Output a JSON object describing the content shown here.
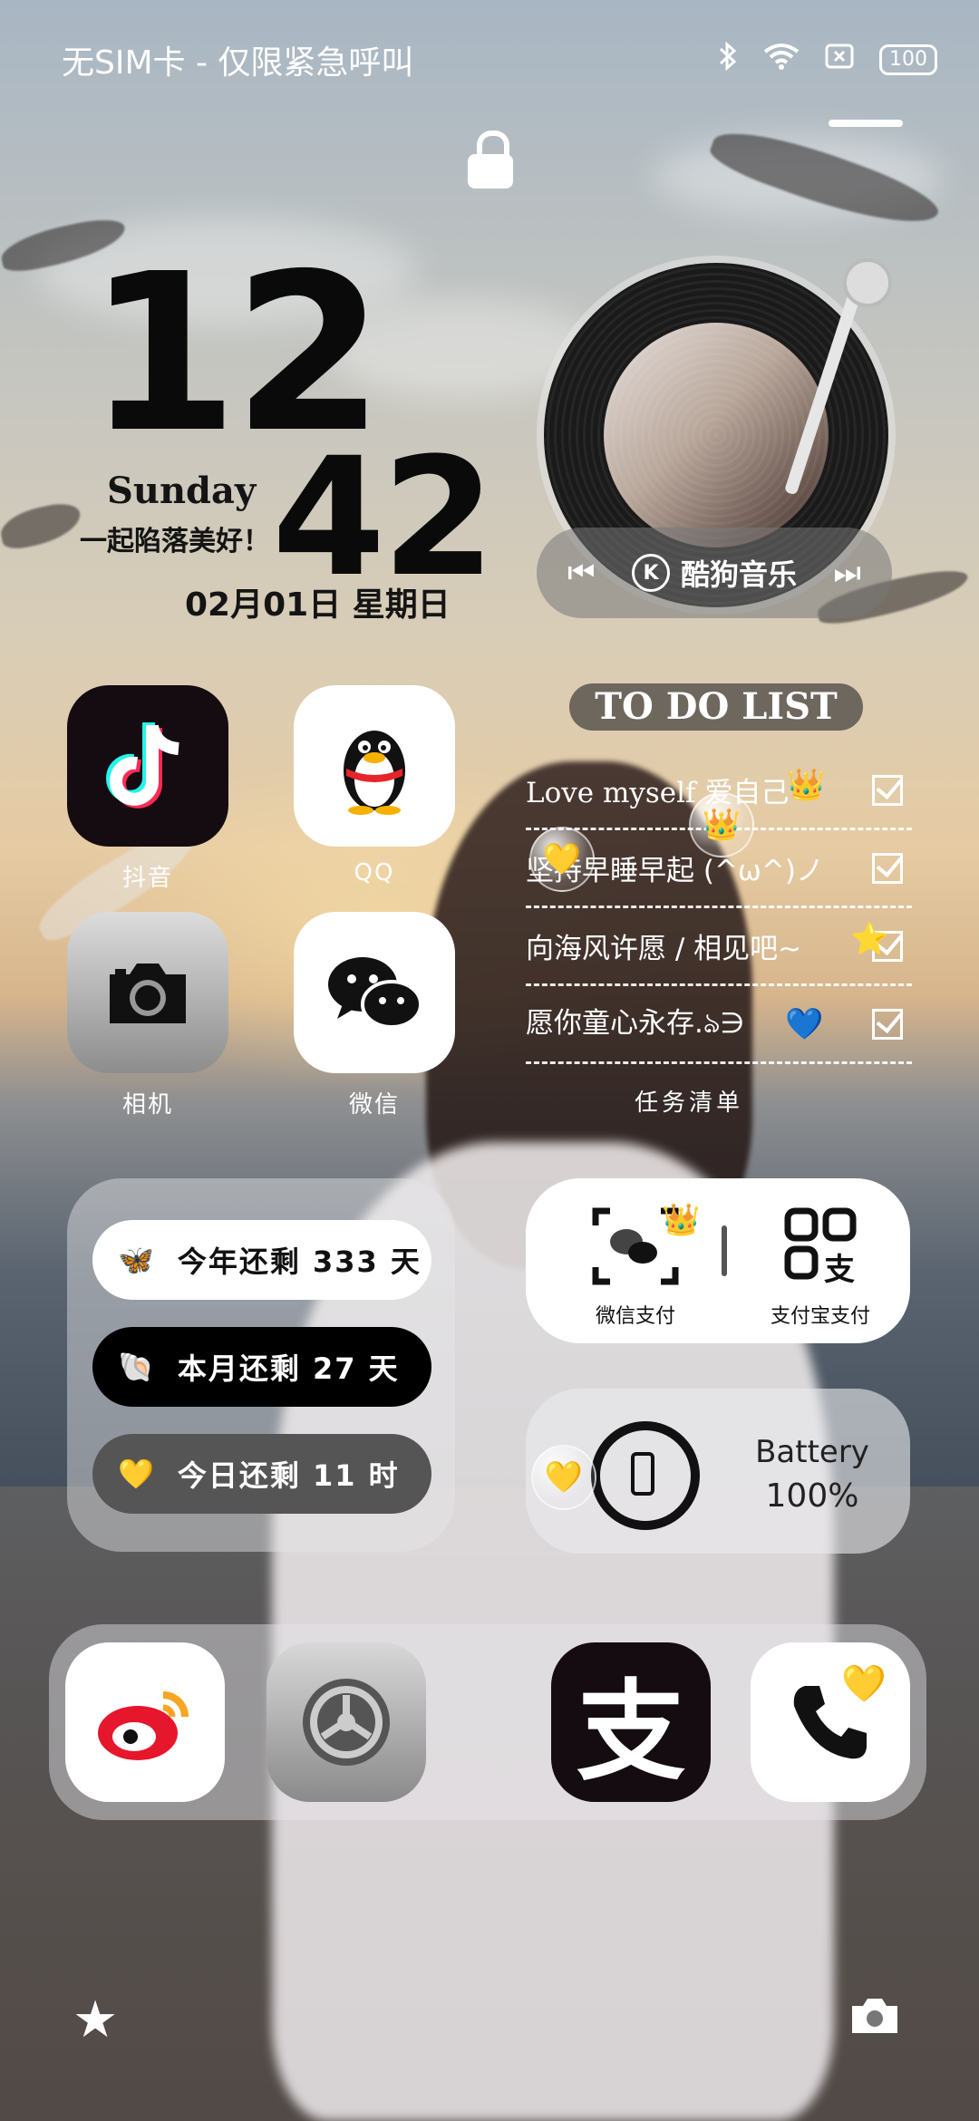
{
  "status_bar": {
    "carrier": "无SIM卡 - 仅限紧急呼叫",
    "battery": "100",
    "icons": [
      "bluetooth-icon",
      "wifi-icon",
      "no-sim-icon",
      "battery-icon"
    ]
  },
  "clock": {
    "hour": "12",
    "minute": "42",
    "day_en": "Sunday",
    "slogan": "一起陷落美好！",
    "date": "02月01日  星期日"
  },
  "music": {
    "app_name": "酷狗音乐",
    "logo_letter": "K",
    "prev_icon": "previous-track-icon",
    "next_icon": "next-track-icon"
  },
  "apps": [
    {
      "label": "抖音",
      "icon": "douyin-icon"
    },
    {
      "label": "QQ",
      "icon": "qq-penguin-icon"
    },
    {
      "label": "相机",
      "icon": "camera-icon"
    },
    {
      "label": "微信",
      "icon": "wechat-icon"
    }
  ],
  "todo": {
    "title": "TO DO LIST",
    "items": [
      {
        "text": "Love myself 爱自己",
        "checked": true
      },
      {
        "text": "坚持早睡早起 (^ω^)ノ",
        "checked": true
      },
      {
        "text": "向海风许愿 / 相见吧~",
        "checked": true
      },
      {
        "text": "愿你童心永存.ঌ∋",
        "checked": true
      }
    ],
    "caption": "任务清单"
  },
  "countdown": [
    {
      "text": "今年还剩 333 天",
      "icon": "butterfly-icon"
    },
    {
      "text": "本月还剩  27  天",
      "icon": "shell-icon"
    },
    {
      "text": "今日还剩  11  时",
      "icon": "yellow-heart-icon"
    }
  ],
  "pay": {
    "wechat_label": "微信支付",
    "alipay_label": "支付宝支付",
    "alipay_char": "支"
  },
  "battery_widget": {
    "label": "Battery",
    "value": "100%"
  },
  "dock": [
    {
      "icon": "weibo-icon"
    },
    {
      "icon": "settings-icon"
    },
    {
      "icon": "alipay-icon",
      "char": "支"
    },
    {
      "icon": "phone-icon"
    }
  ],
  "bottom": {
    "left_icon": "star-icon",
    "right_icon": "camera-shortcut-icon"
  },
  "colors": {
    "douyin_bg": "#140c10",
    "alipay_bg": "#140c10",
    "countdown_pill_1": "#ffffff",
    "countdown_pill_2": "#000000",
    "countdown_pill_3": "#555555"
  }
}
